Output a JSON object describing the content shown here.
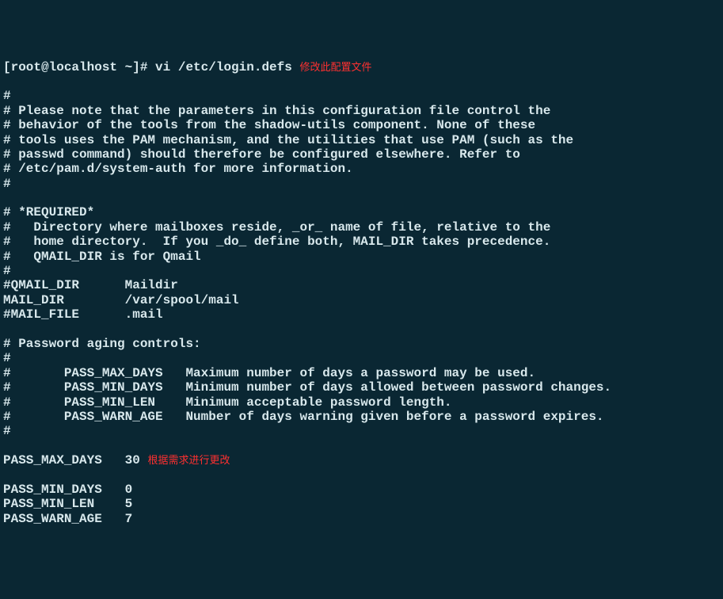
{
  "prompt": "[root@localhost ~]# vi /etc/login.defs ",
  "annotation_top": "修改此配置文件",
  "annotation_bottom": "根据需求进行更改",
  "lines": [
    "#",
    "# Please note that the parameters in this configuration file control the",
    "# behavior of the tools from the shadow-utils component. None of these",
    "# tools uses the PAM mechanism, and the utilities that use PAM (such as the",
    "# passwd command) should therefore be configured elsewhere. Refer to",
    "# /etc/pam.d/system-auth for more information.",
    "#",
    "",
    "# *REQUIRED*",
    "#   Directory where mailboxes reside, _or_ name of file, relative to the",
    "#   home directory.  If you _do_ define both, MAIL_DIR takes precedence.",
    "#   QMAIL_DIR is for Qmail",
    "#",
    "#QMAIL_DIR      Maildir",
    "MAIL_DIR        /var/spool/mail",
    "#MAIL_FILE      .mail",
    "",
    "# Password aging controls:",
    "#",
    "#       PASS_MAX_DAYS   Maximum number of days a password may be used.",
    "#       PASS_MIN_DAYS   Minimum number of days allowed between password changes.",
    "#       PASS_MIN_LEN    Minimum acceptable password length.",
    "#       PASS_WARN_AGE   Number of days warning given before a password expires.",
    "#"
  ],
  "pass_max_days": "PASS_MAX_DAYS   30 ",
  "pass_lines_rest": [
    "PASS_MIN_DAYS   0",
    "PASS_MIN_LEN    5",
    "PASS_WARN_AGE   7"
  ]
}
